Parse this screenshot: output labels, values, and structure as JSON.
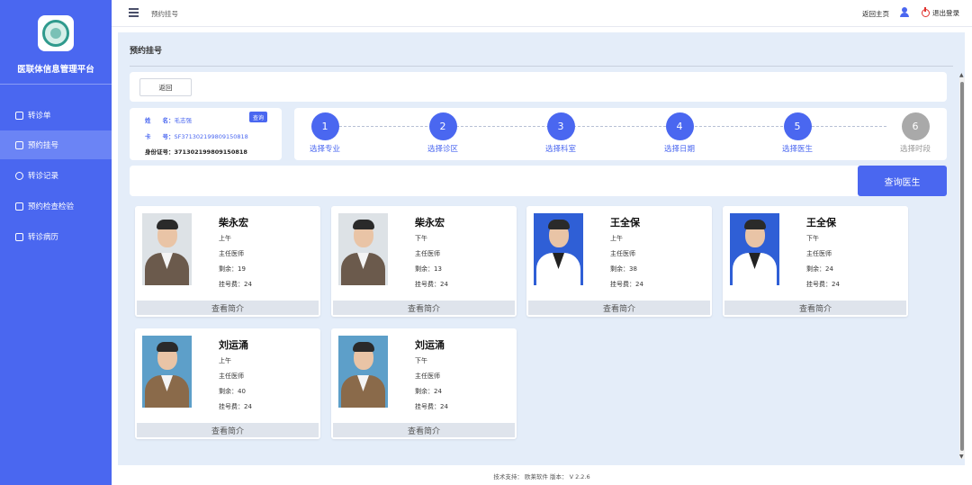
{
  "app": {
    "title": "医联体信息管理平台"
  },
  "sidebar": {
    "items": [
      {
        "label": "转诊单",
        "icon": "edit-icon"
      },
      {
        "label": "预约挂号",
        "icon": "register-icon",
        "active": true
      },
      {
        "label": "转诊记录",
        "icon": "record-icon"
      },
      {
        "label": "预约检查检验",
        "icon": "exam-icon"
      },
      {
        "label": "转诊病历",
        "icon": "medical-record-icon"
      }
    ]
  },
  "topbar": {
    "breadcrumb": "预约挂号",
    "home_link": "返回主页",
    "logout_label": "退出登录"
  },
  "page": {
    "title": "预约挂号",
    "back_label": "返回"
  },
  "patient": {
    "name_label": "姓　　名：",
    "name_value": "毛志强",
    "card_label": "卡　　号：",
    "card_value": "SF371302199809150818",
    "id_label": "身份证号：",
    "id_value": "371302199809150818",
    "query_label": "查询"
  },
  "steps": [
    {
      "num": "1",
      "label": "选择专业",
      "done": true
    },
    {
      "num": "2",
      "label": "选择诊区",
      "done": true
    },
    {
      "num": "3",
      "label": "选择科室",
      "done": true
    },
    {
      "num": "4",
      "label": "选择日期",
      "done": true
    },
    {
      "num": "5",
      "label": "选择医生",
      "done": true
    },
    {
      "num": "6",
      "label": "选择时段",
      "done": false
    }
  ],
  "search": {
    "button_label": "查询医生"
  },
  "doctors": [
    {
      "name": "柴永宏",
      "session": "上午",
      "title": "主任医师",
      "remaining": "剩余：19",
      "fee": "挂号费：24",
      "intro": "查看简介"
    },
    {
      "name": "柴永宏",
      "session": "下午",
      "title": "主任医师",
      "remaining": "剩余：13",
      "fee": "挂号费：24",
      "intro": "查看简介"
    },
    {
      "name": "王全保",
      "session": "上午",
      "title": "主任医师",
      "remaining": "剩余：38",
      "fee": "挂号费：24",
      "intro": "查看简介"
    },
    {
      "name": "王全保",
      "session": "下午",
      "title": "主任医师",
      "remaining": "剩余：24",
      "fee": "挂号费：24",
      "intro": "查看简介"
    },
    {
      "name": "刘运涌",
      "session": "上午",
      "title": "主任医师",
      "remaining": "剩余：40",
      "fee": "挂号费：24",
      "intro": "查看简介"
    },
    {
      "name": "刘运涌",
      "session": "下午",
      "title": "主任医师",
      "remaining": "剩余：24",
      "fee": "挂号费：24",
      "intro": "查看简介"
    }
  ],
  "footer": {
    "text": "技术支持：  欧莱软件   版本：  V 2.2.6"
  },
  "colors": {
    "primary": "#4a67f0",
    "sidebar": "#4a67f0",
    "main_bg": "#e4edf9",
    "pending_step": "#a9a9a9"
  }
}
